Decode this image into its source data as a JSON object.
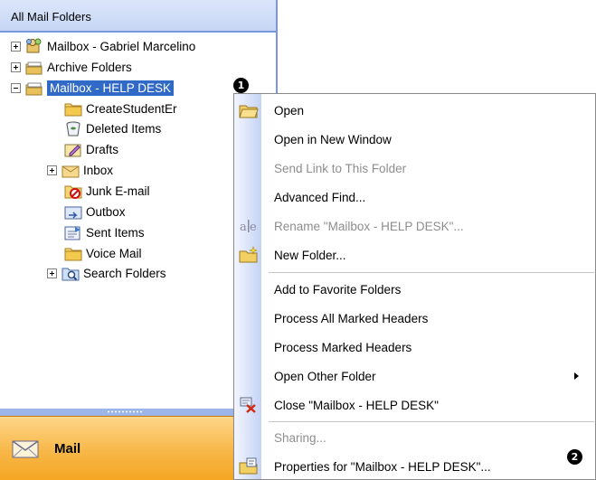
{
  "nav": {
    "header": "All Mail Folders",
    "tree": [
      {
        "label": "Mailbox - Gabriel Marcelino",
        "icon": "mailbox-icon",
        "expander": "plus"
      },
      {
        "label": "Archive Folders",
        "icon": "folder-stack-icon",
        "expander": "plus"
      },
      {
        "label": "Mailbox - HELP DESK",
        "icon": "folder-stack-icon",
        "expander": "minus",
        "selected": true
      },
      {
        "label": "CreateStudentEr",
        "icon": "folder-icon"
      },
      {
        "label": "Deleted Items",
        "icon": "deleted-items-icon"
      },
      {
        "label": "Drafts",
        "icon": "drafts-icon"
      },
      {
        "label": "Inbox",
        "icon": "inbox-icon",
        "expander": "plus"
      },
      {
        "label": "Junk E-mail",
        "icon": "junk-email-icon"
      },
      {
        "label": "Outbox",
        "icon": "outbox-icon"
      },
      {
        "label": "Sent Items",
        "icon": "sent-items-icon"
      },
      {
        "label": "Voice Mail",
        "icon": "folder-icon"
      },
      {
        "label": "Search Folders",
        "icon": "search-folder-icon",
        "expander": "plus"
      }
    ],
    "footer_button": "Mail"
  },
  "badges": {
    "one": "1",
    "two": "2"
  },
  "menu": {
    "items": [
      {
        "label": "Open",
        "icon": "open-folder-icon",
        "disabled": false
      },
      {
        "label": "Open in New Window",
        "disabled": false
      },
      {
        "label": "Send Link to This Folder",
        "disabled": true
      },
      {
        "label": "Advanced Find...",
        "disabled": false
      },
      {
        "label": "Rename \"Mailbox - HELP DESK\"...",
        "icon": "rename-icon",
        "disabled": true
      },
      {
        "label": "New Folder...",
        "icon": "new-folder-icon",
        "disabled": false
      },
      {
        "label": "Add to Favorite Folders",
        "disabled": false
      },
      {
        "label": "Process All Marked Headers",
        "disabled": false
      },
      {
        "label": "Process Marked Headers",
        "disabled": false
      },
      {
        "label": "Open Other Folder",
        "disabled": false,
        "submenu": true
      },
      {
        "label": "Close \"Mailbox - HELP DESK\"",
        "icon": "close-mailbox-icon",
        "disabled": false
      },
      {
        "label": "Sharing...",
        "disabled": true
      },
      {
        "label": "Properties for \"Mailbox - HELP DESK\"...",
        "icon": "properties-icon",
        "disabled": false
      }
    ]
  },
  "colors": {
    "selection": "#3169c6",
    "pane_border": "#7a96df",
    "mail_button": "#f7b748",
    "disabled_text": "#8d8d8d"
  }
}
